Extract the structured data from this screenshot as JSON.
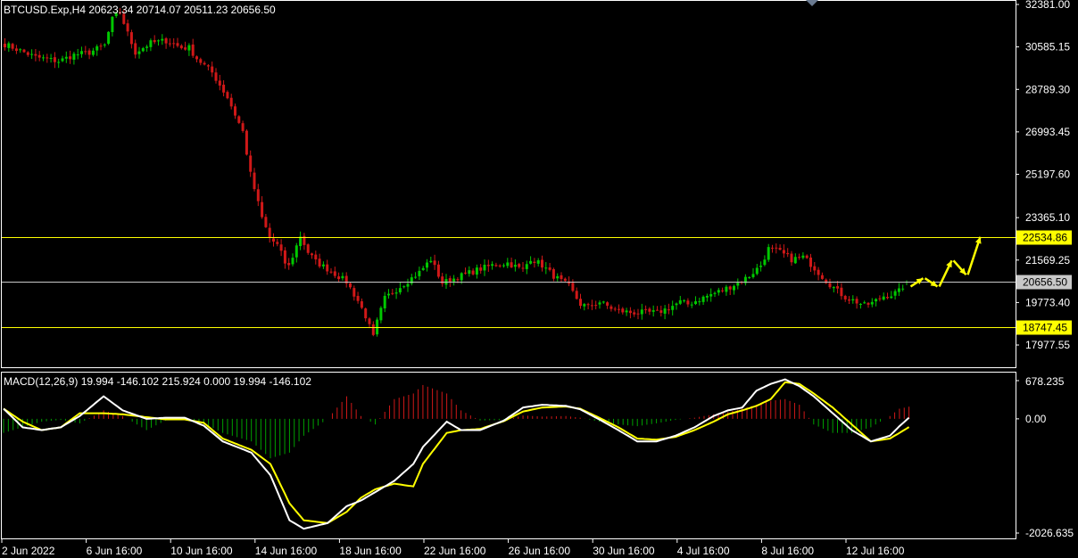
{
  "window": {
    "title": "BTCUSD.Exp,H4  20623.34 20714.07 20511.23 20656.50"
  },
  "colors": {
    "background": "#000000",
    "frame": "#ffffff",
    "bull_candle": "#00c800",
    "bear_candle": "#d01818",
    "level_line": "#ffff00",
    "current_line": "#c8c8c8",
    "macd_line": "#ffffff",
    "signal_line": "#ffff00",
    "hist_positive": "#d01818",
    "hist_negative": "#00a000",
    "arrow": "#ffff00"
  },
  "chart_data": [
    {
      "type": "candlestick",
      "symbol": "BTCUSD.Exp",
      "timeframe": "H4",
      "ohlc_readout": {
        "open": 20623.34,
        "high": 20714.07,
        "low": 20511.23,
        "close": 20656.5
      },
      "ylim": [
        17300,
        32381
      ],
      "y_tick_labels": [
        "32381.00",
        "30585.15",
        "28789.30",
        "26993.45",
        "25197.60",
        "23365.10",
        "21569.25",
        "19773.40",
        "17977.55"
      ],
      "y_ticks": [
        32381.0,
        30585.15,
        28789.3,
        26993.45,
        25197.6,
        23365.1,
        21569.25,
        19773.4,
        17977.55
      ],
      "x_tick_labels": [
        "2 Jun 2022",
        "6 Jun 16:00",
        "10 Jun 16:00",
        "14 Jun 16:00",
        "18 Jun 16:00",
        "22 Jun 16:00",
        "26 Jun 16:00",
        "30 Jun 16:00",
        "4 Jul 16:00",
        "8 Jul 16:00",
        "12 Jul 16:00"
      ],
      "close_path": [
        [
          30700,
          0
        ],
        [
          30150,
          8
        ],
        [
          29980,
          14
        ],
        [
          30250,
          18
        ],
        [
          30350,
          22
        ],
        [
          30650,
          26
        ],
        [
          31750,
          28
        ],
        [
          32050,
          30
        ],
        [
          31150,
          32
        ],
        [
          30350,
          34
        ],
        [
          30750,
          38
        ],
        [
          30850,
          42
        ],
        [
          30550,
          46
        ],
        [
          30550,
          48
        ],
        [
          30100,
          50
        ],
        [
          29500,
          54
        ],
        [
          28450,
          58
        ],
        [
          27000,
          62
        ],
        [
          25200,
          64
        ],
        [
          23350,
          67
        ],
        [
          22500,
          69
        ],
        [
          22200,
          71
        ],
        [
          21850,
          72
        ],
        [
          21450,
          73
        ],
        [
          21300,
          74
        ],
        [
          22600,
          77
        ],
        [
          21900,
          79
        ],
        [
          21500,
          81
        ],
        [
          21100,
          85
        ],
        [
          20650,
          89
        ],
        [
          19850,
          92
        ],
        [
          19200,
          94
        ],
        [
          18300,
          96
        ],
        [
          18950,
          97
        ],
        [
          19950,
          99
        ],
        [
          20450,
          103
        ],
        [
          21050,
          108
        ],
        [
          21600,
          111
        ],
        [
          20600,
          114
        ],
        [
          20850,
          118
        ],
        [
          21150,
          123
        ],
        [
          21350,
          127
        ],
        [
          21450,
          131
        ],
        [
          21150,
          135
        ],
        [
          21650,
          137
        ],
        [
          21350,
          140
        ],
        [
          20900,
          143
        ],
        [
          20450,
          147
        ],
        [
          19700,
          150
        ],
        [
          19600,
          152
        ],
        [
          19800,
          155
        ],
        [
          19450,
          159
        ],
        [
          19350,
          163
        ],
        [
          19350,
          167
        ],
        [
          19350,
          170
        ],
        [
          19550,
          173
        ],
        [
          19800,
          176
        ],
        [
          19700,
          178
        ],
        [
          20050,
          183
        ],
        [
          20300,
          187
        ],
        [
          20600,
          191
        ],
        [
          20900,
          194
        ],
        [
          21350,
          197
        ],
        [
          22050,
          199
        ],
        [
          21900,
          202
        ],
        [
          21600,
          205
        ],
        [
          21700,
          208
        ],
        [
          21400,
          210
        ],
        [
          21050,
          212
        ],
        [
          20700,
          214
        ],
        [
          20250,
          217
        ],
        [
          20000,
          219
        ],
        [
          19800,
          222
        ],
        [
          19650,
          224
        ],
        [
          19750,
          226
        ],
        [
          20050,
          229
        ],
        [
          20100,
          231
        ],
        [
          20250,
          233
        ],
        [
          20656.5,
          235
        ]
      ],
      "levels": [
        {
          "price": 22534.86,
          "label": "22534.86",
          "color": "#ffff00"
        },
        {
          "price": 20656.5,
          "label": "20656.50",
          "color": "#c8c8c8"
        },
        {
          "price": 18747.45,
          "label": "18747.45",
          "color": "#ffff00"
        }
      ],
      "forecast_arrows": [
        {
          "from": 20450,
          "to": 20800
        },
        {
          "from": 20800,
          "to": 20450
        },
        {
          "from": 20450,
          "to": 21550
        },
        {
          "from": 21550,
          "to": 20950
        },
        {
          "from": 20950,
          "to": 22550
        }
      ]
    },
    {
      "type": "macd",
      "title": "MACD(12,26,9) 19.994 -146.102 215.924 0.000 19.994 -146.102",
      "ylim": [
        -2026.635,
        678.235
      ],
      "y_tick_labels": [
        "678.235",
        "0.00",
        "-2026.635"
      ],
      "y_ticks": [
        678.235,
        0.0,
        -2026.635
      ],
      "macd_path": [
        [
          180,
          0
        ],
        [
          -150,
          4
        ],
        [
          -200,
          8
        ],
        [
          -150,
          12
        ],
        [
          50,
          16
        ],
        [
          400,
          21
        ],
        [
          150,
          25
        ],
        [
          0,
          30
        ],
        [
          20,
          34
        ],
        [
          20,
          38
        ],
        [
          -120,
          42
        ],
        [
          -400,
          46
        ],
        [
          -600,
          52
        ],
        [
          -1000,
          56
        ],
        [
          -1800,
          60
        ],
        [
          -1950,
          63
        ],
        [
          -1850,
          68
        ],
        [
          -1550,
          72
        ],
        [
          -1450,
          75
        ],
        [
          -1300,
          78
        ],
        [
          -1100,
          82
        ],
        [
          -800,
          86
        ],
        [
          -500,
          88
        ],
        [
          -50,
          93
        ],
        [
          -200,
          96
        ],
        [
          -200,
          100
        ],
        [
          -30,
          105
        ],
        [
          200,
          109
        ],
        [
          250,
          113
        ],
        [
          230,
          118
        ],
        [
          170,
          121
        ],
        [
          -10,
          125
        ],
        [
          -200,
          129
        ],
        [
          -400,
          133
        ],
        [
          -400,
          137
        ],
        [
          -300,
          141
        ],
        [
          -150,
          145
        ],
        [
          50,
          149
        ],
        [
          150,
          152
        ],
        [
          200,
          155
        ],
        [
          500,
          158
        ],
        [
          620,
          161
        ],
        [
          700,
          164
        ],
        [
          580,
          167
        ],
        [
          400,
          170
        ],
        [
          100,
          174
        ],
        [
          -200,
          178
        ],
        [
          -400,
          182
        ],
        [
          -300,
          186
        ],
        [
          -130,
          188
        ],
        [
          19.994,
          190
        ]
      ],
      "signal_path": [
        [
          180,
          0
        ],
        [
          -50,
          4
        ],
        [
          -200,
          8
        ],
        [
          -150,
          12
        ],
        [
          100,
          16
        ],
        [
          100,
          21
        ],
        [
          80,
          25
        ],
        [
          30,
          30
        ],
        [
          -10,
          34
        ],
        [
          -10,
          38
        ],
        [
          -70,
          42
        ],
        [
          -350,
          46
        ],
        [
          -550,
          52
        ],
        [
          -800,
          56
        ],
        [
          -1500,
          60
        ],
        [
          -1800,
          63
        ],
        [
          -1850,
          68
        ],
        [
          -1650,
          72
        ],
        [
          -1400,
          75
        ],
        [
          -1250,
          78
        ],
        [
          -1150,
          82
        ],
        [
          -1200,
          86
        ],
        [
          -800,
          88
        ],
        [
          -250,
          93
        ],
        [
          -200,
          96
        ],
        [
          -180,
          100
        ],
        [
          -40,
          105
        ],
        [
          130,
          109
        ],
        [
          200,
          113
        ],
        [
          220,
          118
        ],
        [
          180,
          121
        ],
        [
          20,
          125
        ],
        [
          -150,
          129
        ],
        [
          -350,
          133
        ],
        [
          -370,
          137
        ],
        [
          -320,
          141
        ],
        [
          -200,
          145
        ],
        [
          -50,
          149
        ],
        [
          80,
          152
        ],
        [
          150,
          155
        ],
        [
          230,
          158
        ],
        [
          350,
          161
        ],
        [
          650,
          164
        ],
        [
          620,
          167
        ],
        [
          450,
          170
        ],
        [
          200,
          174
        ],
        [
          -100,
          178
        ],
        [
          -400,
          182
        ],
        [
          -350,
          186
        ],
        [
          -250,
          188
        ],
        [
          -146.102,
          190
        ]
      ],
      "hist_path": [
        [
          -250,
          0
        ],
        [
          -150,
          4
        ],
        [
          -50,
          8
        ],
        [
          -20,
          12
        ],
        [
          -80,
          16
        ],
        [
          150,
          21
        ],
        [
          50,
          25
        ],
        [
          -200,
          30
        ],
        [
          -30,
          34
        ],
        [
          30,
          38
        ],
        [
          -80,
          42
        ],
        [
          -250,
          46
        ],
        [
          -400,
          52
        ],
        [
          -700,
          56
        ],
        [
          -600,
          60
        ],
        [
          -300,
          63
        ],
        [
          0,
          68
        ],
        [
          400,
          72
        ],
        [
          50,
          75
        ],
        [
          -100,
          78
        ],
        [
          350,
          82
        ],
        [
          450,
          86
        ],
        [
          600,
          88
        ],
        [
          450,
          93
        ],
        [
          150,
          96
        ],
        [
          -30,
          100
        ],
        [
          -20,
          105
        ],
        [
          60,
          109
        ],
        [
          40,
          113
        ],
        [
          50,
          118
        ],
        [
          20,
          121
        ],
        [
          -50,
          125
        ],
        [
          -100,
          129
        ],
        [
          -130,
          133
        ],
        [
          -80,
          137
        ],
        [
          -20,
          141
        ],
        [
          20,
          145
        ],
        [
          80,
          149
        ],
        [
          120,
          152
        ],
        [
          180,
          155
        ],
        [
          250,
          158
        ],
        [
          320,
          161
        ],
        [
          350,
          164
        ],
        [
          250,
          167
        ],
        [
          -100,
          170
        ],
        [
          -250,
          174
        ],
        [
          -250,
          178
        ],
        [
          -150,
          182
        ],
        [
          50,
          186
        ],
        [
          180,
          188
        ],
        [
          215.924,
          190
        ]
      ]
    }
  ]
}
